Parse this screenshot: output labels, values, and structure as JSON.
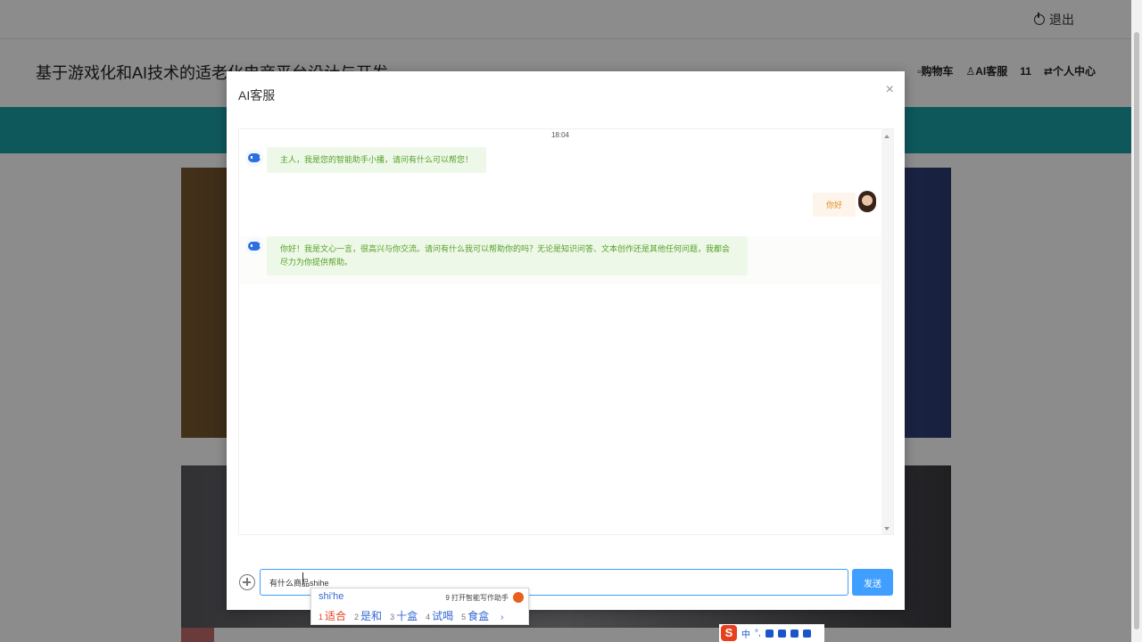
{
  "topbar": {
    "logout_label": "退出"
  },
  "header": {
    "site_title": "基于游戏化和AI技术的适老化电商平台设计与开发",
    "nav": {
      "cart": "购物车",
      "ai_service": "AI客服",
      "count": "11",
      "profile": "个人中心"
    }
  },
  "dialog": {
    "title": "AI客服",
    "close": "×",
    "time": "18:04",
    "messages": [
      {
        "from": "bot",
        "text": "主人，我是您的智能助手小播，请问有什么可以帮您！"
      },
      {
        "from": "user",
        "text": "你好"
      },
      {
        "from": "bot",
        "text": "你好！我是文心一言，很高兴与你交流。请问有什么我可以帮助你的吗？无论是知识问答、文本创作还是其他任何问题，我都会尽力为你提供帮助。"
      }
    ],
    "input_value": "有什么商品shihe",
    "send_label": "发送"
  },
  "ime": {
    "composition": "shi'he",
    "assist_label": "9 打开智能写作助手",
    "candidates": [
      {
        "n": "1",
        "text": "适合"
      },
      {
        "n": "2",
        "text": "是和"
      },
      {
        "n": "3",
        "text": "十盒"
      },
      {
        "n": "4",
        "text": "试喝"
      },
      {
        "n": "5",
        "text": "食盒"
      }
    ],
    "next": "›",
    "toolbar": {
      "logo": "S",
      "lang": "中",
      "punct": "°,"
    }
  },
  "colors": {
    "teal": "#1aa0a8",
    "primary": "#409eff",
    "bot_bubble": "#eef8e8",
    "user_bubble": "#fdf4ec"
  }
}
